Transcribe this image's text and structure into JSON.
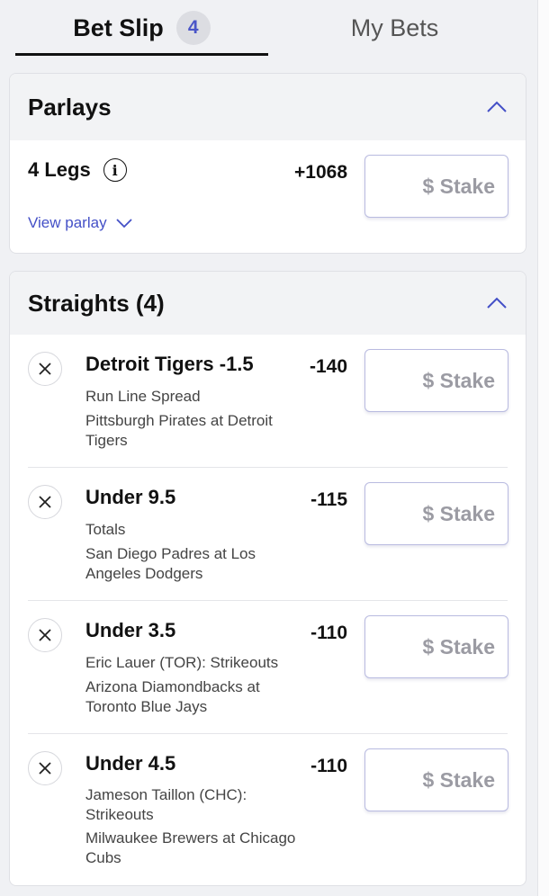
{
  "tabs": {
    "bet_slip": "Bet Slip",
    "bet_slip_count": "4",
    "my_bets": "My Bets"
  },
  "parlays": {
    "title": "Parlays",
    "legs_label": "4 Legs",
    "odds": "+1068",
    "view_label": "View parlay",
    "stake_placeholder": "$ Stake"
  },
  "straights": {
    "title": "Straights (4)",
    "stake_placeholder": "$ Stake",
    "legs": [
      {
        "title": "Detroit Tigers -1.5",
        "type": "Run Line Spread",
        "game": "Pittsburgh Pirates at Detroit Tigers",
        "odds": "-140"
      },
      {
        "title": "Under 9.5",
        "type": "Totals",
        "game": "San Diego Padres at Los Angeles Dodgers",
        "odds": "-115"
      },
      {
        "title": "Under 3.5",
        "type": "Eric Lauer (TOR): Strikeouts",
        "game": "Arizona Diamondbacks at Toronto Blue Jays",
        "odds": "-110"
      },
      {
        "title": "Under 4.5",
        "type": "Jameson Taillon (CHC): Strikeouts",
        "game": "Milwaukee Brewers at Chicago Cubs",
        "odds": "-110"
      }
    ]
  },
  "colors": {
    "accent": "#4450c7",
    "badge_bg": "#dcdde2",
    "panel_bg": "#f0f1f4"
  }
}
